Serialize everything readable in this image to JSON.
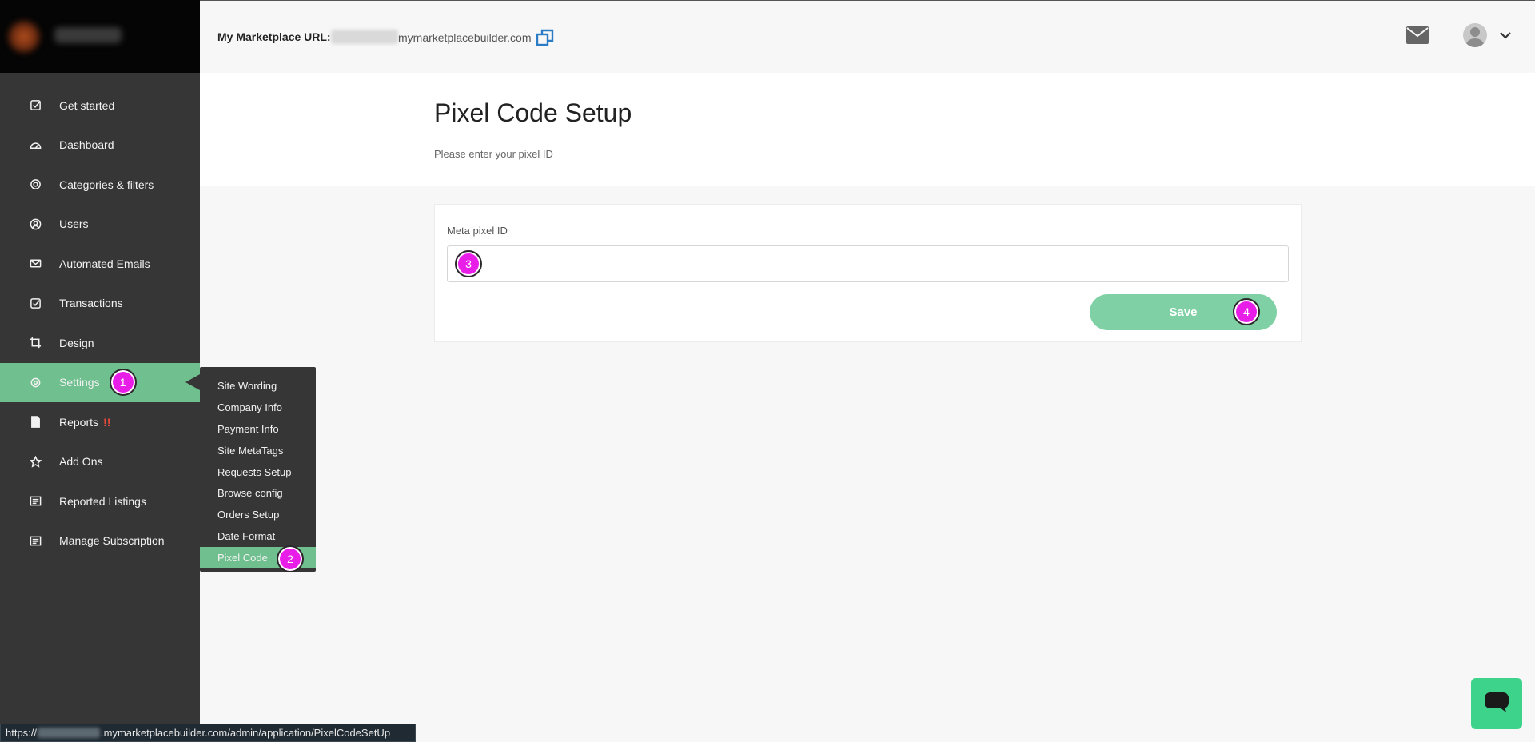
{
  "header": {
    "url_label": "My Marketplace URL:",
    "url_domain": "mymarketplacebuilder.com"
  },
  "sidebar": {
    "items": [
      {
        "label": "Get started",
        "icon": "checkbox-icon"
      },
      {
        "label": "Dashboard",
        "icon": "gauge-icon"
      },
      {
        "label": "Categories & filters",
        "icon": "target-icon"
      },
      {
        "label": "Users",
        "icon": "user-circle-icon"
      },
      {
        "label": "Automated Emails",
        "icon": "envelope-icon"
      },
      {
        "label": "Transactions",
        "icon": "checkbox-icon"
      },
      {
        "label": "Design",
        "icon": "crop-icon"
      },
      {
        "label": "Settings",
        "icon": "gear-icon",
        "marker": "1"
      },
      {
        "label": "Reports",
        "icon": "document-icon",
        "alert": "!!"
      },
      {
        "label": "Add Ons",
        "icon": "star-icon"
      },
      {
        "label": "Reported Listings",
        "icon": "list-icon"
      },
      {
        "label": "Manage Subscription",
        "icon": "list-icon"
      }
    ]
  },
  "submenu": {
    "items": [
      "Site Wording",
      "Company Info",
      "Payment Info",
      "Site MetaTags",
      "Requests Setup",
      "Browse config",
      "Orders Setup",
      "Date Format",
      "Pixel Code"
    ],
    "marker": "2"
  },
  "page": {
    "title": "Pixel Code Setup",
    "subtitle": "Please enter your pixel ID"
  },
  "form": {
    "label": "Meta pixel ID",
    "value": "",
    "input_marker": "3",
    "save_label": "Save",
    "save_marker": "4"
  },
  "statusbar": {
    "prefix": "https://",
    "suffix": ".mymarketplacebuilder.com/admin/application/PixelCodeSetUp"
  },
  "colors": {
    "sidebar_bg": "#363636",
    "accent_green": "#6fbf8f",
    "save_button": "#7fd1a5",
    "marker_magenta": "#e81ee8",
    "copy_icon_blue": "#2b7cc6",
    "chat_green": "#3ed38a"
  }
}
